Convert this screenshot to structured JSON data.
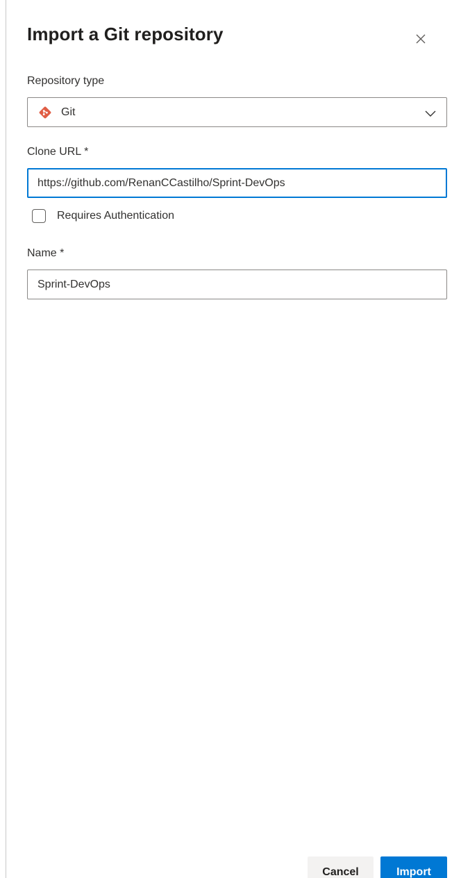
{
  "dialog": {
    "title": "Import a Git repository",
    "close_icon": "close-icon"
  },
  "repository_type": {
    "label": "Repository type",
    "selected": "Git",
    "icon": "git-icon",
    "icon_color": "#e05d44"
  },
  "clone_url": {
    "label": "Clone URL *",
    "value": "https://github.com/RenanCCastilho/Sprint-DevOps"
  },
  "authentication": {
    "label": "Requires Authentication",
    "checked": false
  },
  "name_field": {
    "label": "Name *",
    "value": "Sprint-DevOps"
  },
  "footer": {
    "cancel_label": "Cancel",
    "import_label": "Import"
  },
  "colors": {
    "accent": "#0078d4",
    "border": "#8a8886",
    "cancel_bg": "#f3f2f1"
  }
}
